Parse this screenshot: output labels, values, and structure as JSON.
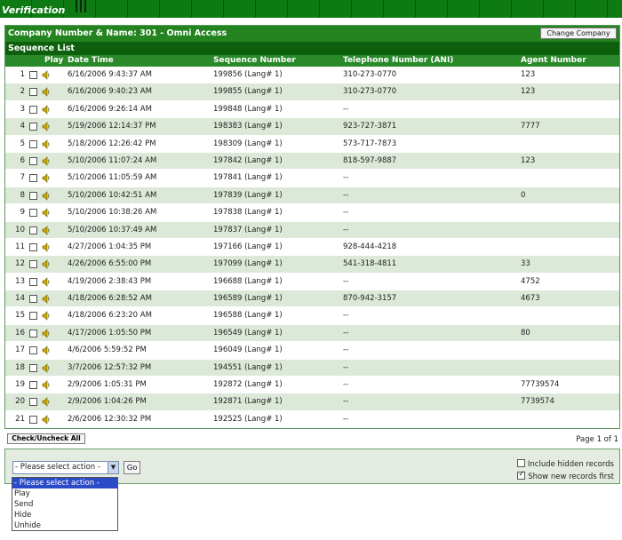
{
  "header": {
    "title": "Verification"
  },
  "company": {
    "label": "Company Number & Name: 301 - Omni Access",
    "change_button": "Change Company"
  },
  "list_title": "Sequence List",
  "columns": {
    "play": "Play",
    "date": "Date Time",
    "sequence": "Sequence Number",
    "telephone": "Telephone Number (ANI)",
    "agent": "Agent Number"
  },
  "rows": [
    {
      "n": "1",
      "date": "6/16/2006 9:43:37 AM",
      "seq": "199856 (Lang# 1)",
      "tel": "310-273-0770",
      "agent": "123"
    },
    {
      "n": "2",
      "date": "6/16/2006 9:40:23 AM",
      "seq": "199855 (Lang# 1)",
      "tel": "310-273-0770",
      "agent": "123"
    },
    {
      "n": "3",
      "date": "6/16/2006 9:26:14 AM",
      "seq": "199848 (Lang# 1)",
      "tel": "--",
      "agent": ""
    },
    {
      "n": "4",
      "date": "5/19/2006 12:14:37 PM",
      "seq": "198383 (Lang# 1)",
      "tel": "923-727-3871",
      "agent": "7777"
    },
    {
      "n": "5",
      "date": "5/18/2006 12:26:42 PM",
      "seq": "198309 (Lang# 1)",
      "tel": "573-717-7873",
      "agent": ""
    },
    {
      "n": "6",
      "date": "5/10/2006 11:07:24 AM",
      "seq": "197842 (Lang# 1)",
      "tel": "818-597-9887",
      "agent": "123"
    },
    {
      "n": "7",
      "date": "5/10/2006 11:05:59 AM",
      "seq": "197841 (Lang# 1)",
      "tel": "--",
      "agent": ""
    },
    {
      "n": "8",
      "date": "5/10/2006 10:42:51 AM",
      "seq": "197839 (Lang# 1)",
      "tel": "--",
      "agent": "0"
    },
    {
      "n": "9",
      "date": "5/10/2006 10:38:26 AM",
      "seq": "197838 (Lang# 1)",
      "tel": "--",
      "agent": ""
    },
    {
      "n": "10",
      "date": "5/10/2006 10:37:49 AM",
      "seq": "197837 (Lang# 1)",
      "tel": "--",
      "agent": ""
    },
    {
      "n": "11",
      "date": "4/27/2006 1:04:35 PM",
      "seq": "197166 (Lang# 1)",
      "tel": "928-444-4218",
      "agent": ""
    },
    {
      "n": "12",
      "date": "4/26/2006 6:55:00 PM",
      "seq": "197099 (Lang# 1)",
      "tel": "541-318-4811",
      "agent": "33"
    },
    {
      "n": "13",
      "date": "4/19/2006 2:38:43 PM",
      "seq": "196688 (Lang# 1)",
      "tel": "--",
      "agent": "4752"
    },
    {
      "n": "14",
      "date": "4/18/2006 6:28:52 AM",
      "seq": "196589 (Lang# 1)",
      "tel": "870-942-3157",
      "agent": "4673"
    },
    {
      "n": "15",
      "date": "4/18/2006 6:23:20 AM",
      "seq": "196588 (Lang# 1)",
      "tel": "--",
      "agent": ""
    },
    {
      "n": "16",
      "date": "4/17/2006 1:05:50 PM",
      "seq": "196549 (Lang# 1)",
      "tel": "--",
      "agent": "80"
    },
    {
      "n": "17",
      "date": "4/6/2006 5:59:52 PM",
      "seq": "196049 (Lang# 1)",
      "tel": "--",
      "agent": ""
    },
    {
      "n": "18",
      "date": "3/7/2006 12:57:32 PM",
      "seq": "194551 (Lang# 1)",
      "tel": "--",
      "agent": ""
    },
    {
      "n": "19",
      "date": "2/9/2006 1:05:31 PM",
      "seq": "192872 (Lang# 1)",
      "tel": "--",
      "agent": "77739574"
    },
    {
      "n": "20",
      "date": "2/9/2006 1:04:26 PM",
      "seq": "192871 (Lang# 1)",
      "tel": "--",
      "agent": "7739574"
    },
    {
      "n": "21",
      "date": "2/6/2006 12:30:32 PM",
      "seq": "192525 (Lang# 1)",
      "tel": "--",
      "agent": ""
    }
  ],
  "footer": {
    "check_all": "Check/Uncheck All",
    "pager": "Page 1 of 1"
  },
  "actions": {
    "selected": "- Please select action -",
    "go": "Go",
    "options": [
      "- Please select action -",
      "Play",
      "Send",
      "Hide",
      "Unhide"
    ],
    "include_hidden": "Include hidden records",
    "show_new_first": "Show new records first"
  },
  "colors": {
    "header_green": "#23841f",
    "dark_green": "#0d5f0d",
    "row_alt": "#dce8d8"
  }
}
